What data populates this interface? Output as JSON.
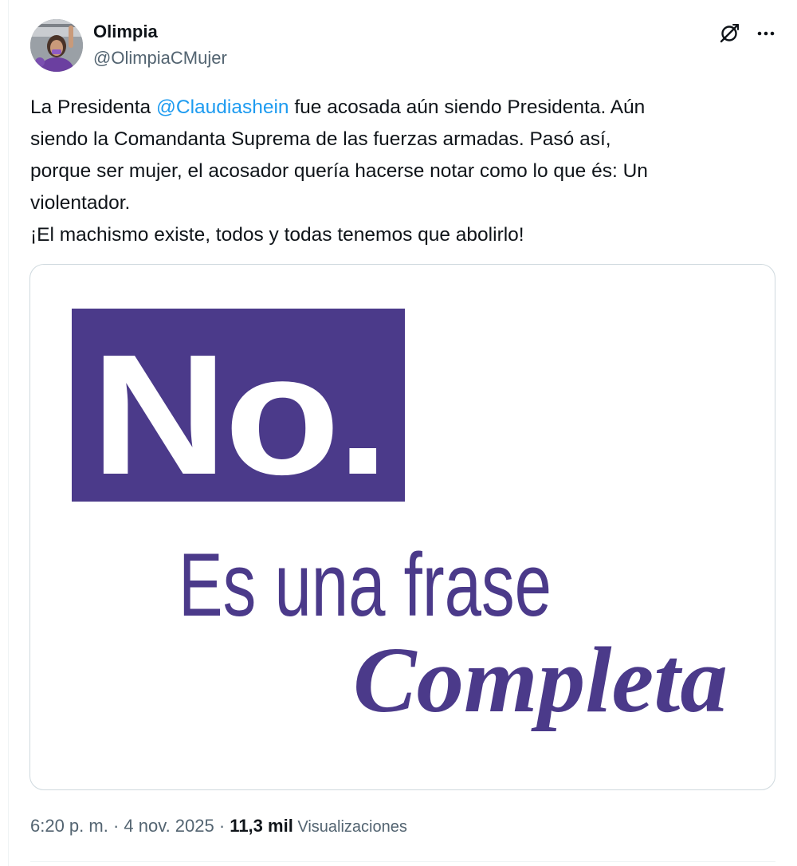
{
  "author": {
    "display_name": "Olimpia",
    "handle": "@OlimpiaCMujer"
  },
  "icons": {
    "grok": "grok-slash-icon",
    "more": "more-horizontal-icon"
  },
  "tweet": {
    "line1_before": "La Presidenta ",
    "mention": "@Claudiashein",
    "line1_after": " fue acosada aún siendo Presidenta. Aún",
    "line2": "siendo la Comandanta Suprema de las fuerzas armadas. Pasó así,",
    "line3": "porque ser mujer, el acosador quería hacerse notar como lo que és: Un",
    "line4": "violentador.",
    "line5": "¡El machismo existe, todos y todas tenemos que abolirlo!"
  },
  "media": {
    "box_text": "No.",
    "line1": "Es una frase",
    "line2": "Completa"
  },
  "meta": {
    "time_date": "6:20 p. m. · 4 nov. 2025 · ",
    "views_count": "11,3 mil",
    "views_label": " Visualizaciones"
  },
  "colors": {
    "brand_purple": "#4b3a8a",
    "link_blue": "#1d9bf0",
    "secondary_text": "#536471",
    "primary_text": "#0f1419",
    "border": "#cfd9de"
  }
}
